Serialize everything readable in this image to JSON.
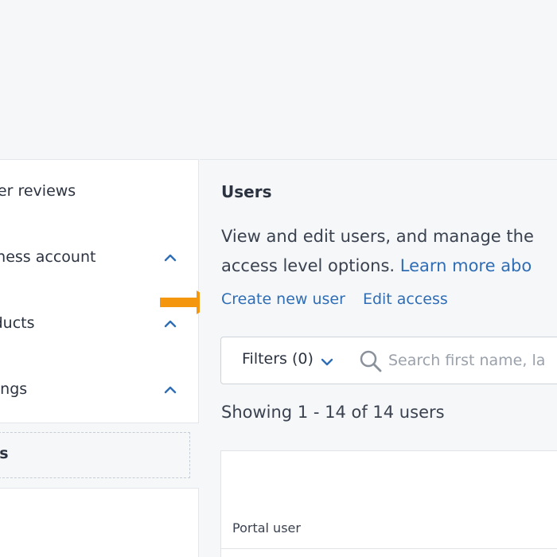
{
  "sidebar": {
    "items": [
      {
        "label": "aler reviews"
      },
      {
        "label": "siness account"
      },
      {
        "label": "oducts"
      },
      {
        "label": "ttings"
      }
    ],
    "active": {
      "label": "ers"
    }
  },
  "main": {
    "title": "Users",
    "description_line1": "View and edit users, and manage the",
    "description_line2_text": "access level options. ",
    "description_link": "Learn more abo",
    "actions": {
      "create": "Create new user",
      "edit": "Edit access"
    },
    "filters_label": "Filters (0)",
    "search_placeholder": "Search first name, la",
    "showing_text": "Showing 1 - 14 of 14 users",
    "table": {
      "columns": [
        "Portal user"
      ]
    }
  },
  "colors": {
    "accent_link": "#2f6db5",
    "arrow": "#f5960f"
  },
  "icons": {
    "chevron": "chevron-up-icon",
    "filter_chevron": "chevron-down-icon",
    "search": "search-icon",
    "arrow": "arrow-right-icon"
  }
}
